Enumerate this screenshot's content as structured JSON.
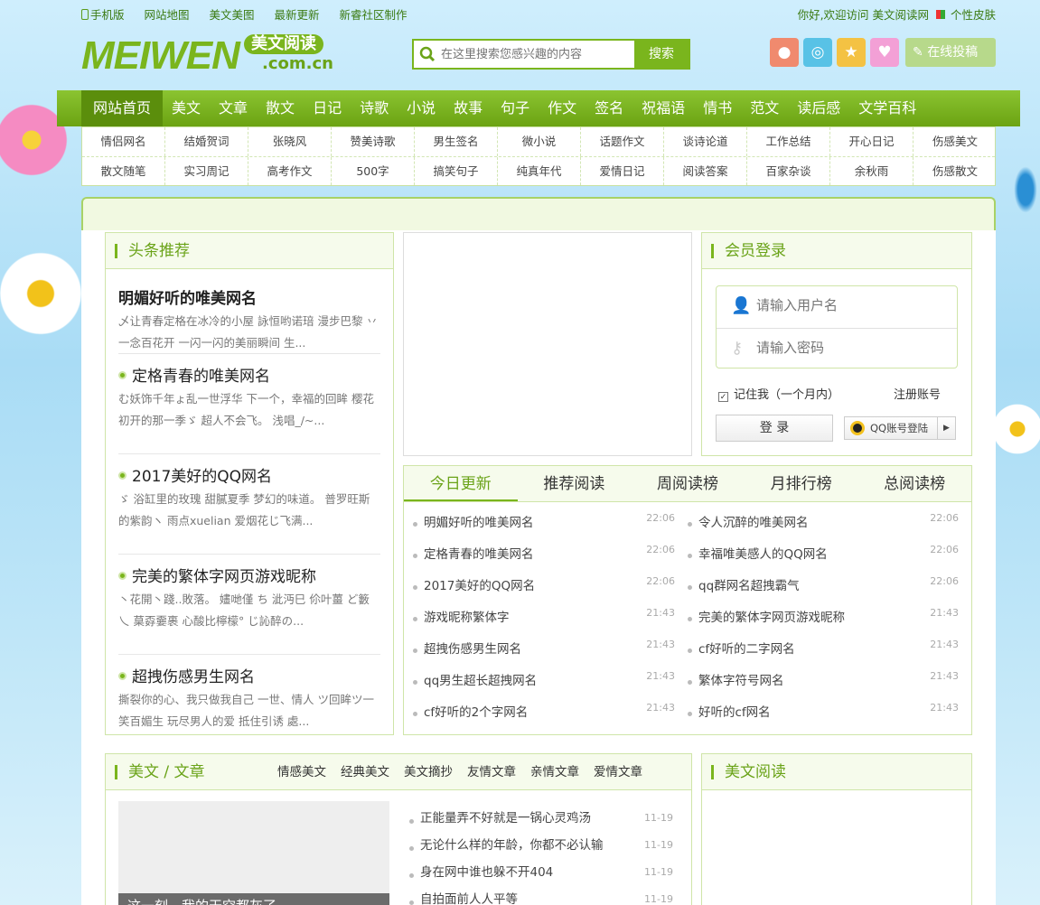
{
  "topbar": {
    "links": [
      "手机版",
      "网站地图",
      "美文美图",
      "最新更新",
      "新睿社区制作"
    ],
    "welcome": "你好,欢迎访问 美文阅读网",
    "skin": "个性皮肤"
  },
  "logo": {
    "main": "MEIWEN",
    "pill": "美文阅读",
    "domain": ".com.cn"
  },
  "search": {
    "placeholder": "在这里搜索您感兴趣的内容",
    "button": "搜索"
  },
  "social": {
    "icons": [
      "weibo-icon",
      "tencent-weibo-icon",
      "star-icon",
      "heart-icon"
    ],
    "colors": [
      "#f08a6e",
      "#58c2e6",
      "#f4c243",
      "#f3a0d6"
    ],
    "tougao": "在线投稿"
  },
  "nav": {
    "items": [
      "网站首页",
      "美文",
      "文章",
      "散文",
      "日记",
      "诗歌",
      "小说",
      "故事",
      "句子",
      "作文",
      "签名",
      "祝福语",
      "情书",
      "范文",
      "读后感",
      "文学百科"
    ]
  },
  "subnav": {
    "row1": [
      "情侣网名",
      "结婚贺词",
      "张晓风",
      "赞美诗歌",
      "男生签名",
      "微小说",
      "话题作文",
      "谈诗论道",
      "工作总结",
      "开心日记",
      "伤感美文"
    ],
    "row2": [
      "散文随笔",
      "实习周记",
      "高考作文",
      "500字",
      "搞笑句子",
      "纯真年代",
      "爱情日记",
      "阅读答案",
      "百家杂谈",
      "余秋雨",
      "伤感散文"
    ]
  },
  "headline": {
    "title": "头条推荐",
    "top": {
      "title": "明媚好听的唯美网名",
      "desc": "乄让青春定格在冰冷的小屋 詠恒哟诺琣 漫步巴黎 丷一念百花开 一闪一闪的美丽瞬间 生..."
    },
    "items": [
      {
        "title": "定格青春的唯美网名",
        "desc": "む妖饰千年ょ乱一世浮华 下一个，幸福的回眸 樱花初开的那一季ゞ 超人不会飞。 浅唱_/~..."
      },
      {
        "title": "2017美好的QQ网名",
        "desc": "ゞ 浴缸里的玫瑰 甜膩夏季 梦幻的味道。 普罗旺斯的紫韵ヽ 雨点xuelian 爱烟花じ飞满..."
      },
      {
        "title": "完美的繁体字网页游戏昵称",
        "desc": "丶花開丶踐..敗落。 嫿哋僅 ち 泚沔巳 伱叶薑 ど籔乀 菒孬嫑裹 心酸比檸檬° じ訫醉の..."
      },
      {
        "title": "超拽伤感男生网名",
        "desc": "撕裂你的心、我只做我自己 一世、情人 ツ回眸ツ一笑百媚生 玩尽男人的爱 抵住引诱 處..."
      }
    ]
  },
  "login": {
    "title": "会员登录",
    "user_placeholder": "请输入用户名",
    "pass_placeholder": "请输入密码",
    "remember": "记住我（一个月内）",
    "register": "注册账号",
    "login_btn": "登 录",
    "qq_btn": "QQ账号登陆"
  },
  "updates": {
    "tabs": [
      "今日更新",
      "推荐阅读",
      "周阅读榜",
      "月排行榜",
      "总阅读榜"
    ],
    "left": [
      {
        "t": "明媚好听的唯美网名",
        "time": "22:06"
      },
      {
        "t": "定格青春的唯美网名",
        "time": "22:06"
      },
      {
        "t": "2017美好的QQ网名",
        "time": "22:06"
      },
      {
        "t": "游戏昵称繁体字",
        "time": "21:43"
      },
      {
        "t": "超拽伤感男生网名",
        "time": "21:43"
      },
      {
        "t": "qq男生超长超拽网名",
        "time": "21:43"
      },
      {
        "t": "cf好听的2个字网名",
        "time": "21:43"
      }
    ],
    "right": [
      {
        "t": "令人沉醉的唯美网名",
        "time": "22:06"
      },
      {
        "t": "幸福唯美感人的QQ网名",
        "time": "22:06"
      },
      {
        "t": "qq群网名超拽霸气",
        "time": "22:06"
      },
      {
        "t": "完美的繁体字网页游戏昵称",
        "time": "21:43"
      },
      {
        "t": "cf好听的二字网名",
        "time": "21:43"
      },
      {
        "t": "繁体字符号网名",
        "time": "21:43"
      },
      {
        "t": "好听的cf网名",
        "time": "21:43"
      }
    ]
  },
  "meiwen": {
    "title": "美文 / 文章",
    "cats": [
      "情感美文",
      "经典美文",
      "美文摘抄",
      "友情文章",
      "亲情文章",
      "爱情文章"
    ],
    "caption": "这一刻，我的天空都灰了",
    "list": [
      {
        "t": "正能量弄不好就是一锅心灵鸡汤",
        "time": "11-19"
      },
      {
        "t": "无论什么样的年龄，你都不必认输",
        "time": "11-19"
      },
      {
        "t": "身在网中谁也躲不开404",
        "time": "11-19"
      },
      {
        "t": "自拍面前人人平等",
        "time": "11-19"
      }
    ]
  },
  "side2": {
    "title": "美文阅读"
  }
}
